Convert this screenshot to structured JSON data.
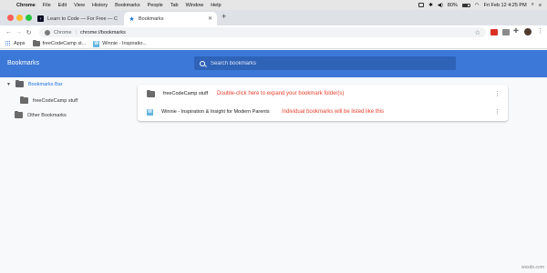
{
  "menubar": {
    "apple": "",
    "items": [
      "Chrome",
      "File",
      "Edit",
      "View",
      "History",
      "Bookmarks",
      "People",
      "Tab",
      "Window",
      "Help"
    ],
    "battery": "80%",
    "clock": "Fri Feb 12 4:25 PM"
  },
  "tabs": [
    {
      "label": "Learn to Code — For Free — C",
      "favicon": "freecodecamp-icon"
    },
    {
      "label": "Bookmarks",
      "favicon": "star-icon"
    }
  ],
  "toolbar": {
    "scheme": "Chrome",
    "path": "chrome://bookmarks"
  },
  "bookmarks_bar": {
    "items": [
      {
        "label": "Apps",
        "icon": "apps-grid-icon"
      },
      {
        "label": "freeCodeCamp st...",
        "icon": "folder-icon"
      },
      {
        "label": "Winnie - Inspiratio...",
        "icon": "winnie-favicon"
      }
    ]
  },
  "header": {
    "title": "Bookmarks",
    "search_placeholder": "Search bookmarks"
  },
  "tree": {
    "items": [
      {
        "label": "Bookmarks Bar",
        "selected": true
      },
      {
        "label": "freeCodeCamp stuff"
      },
      {
        "label": "Other Bookmarks"
      }
    ]
  },
  "list": {
    "rows": [
      {
        "name": "freeCodeCamp stuff",
        "type": "folder",
        "annotation": "Double-click here to expand your bookmark folder(s)"
      },
      {
        "name": "Winnie - Inspiration & Insight for Modern Parents",
        "type": "bookmark",
        "annotation": "Individual bookmarks will be listed like this"
      }
    ]
  },
  "watermark": "wsxdn.com",
  "colors": {
    "header": "#3c78d8",
    "annotation": "#e8412d",
    "accent": "#1a73e8"
  }
}
